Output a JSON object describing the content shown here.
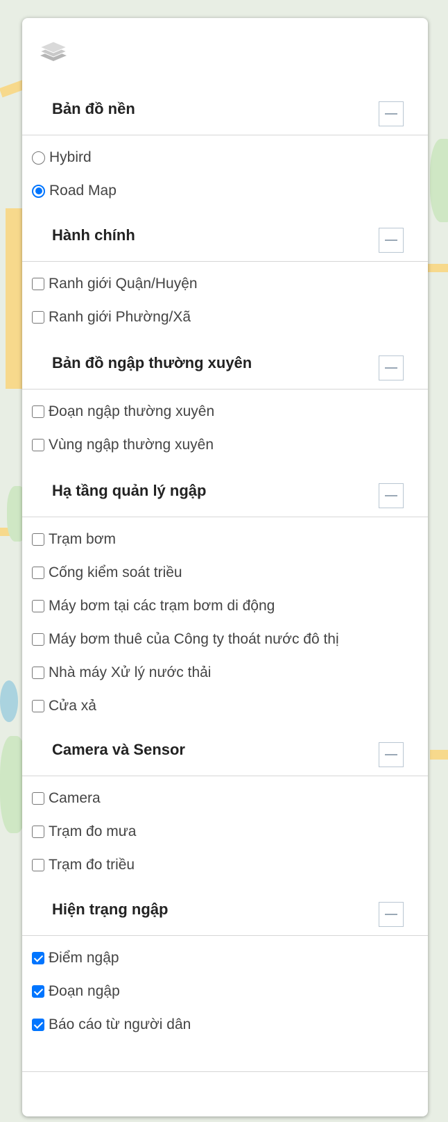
{
  "sections": [
    {
      "title": "Bản đồ nền",
      "type": "radio",
      "items": [
        {
          "label": "Hybird",
          "checked": false
        },
        {
          "label": "Road Map",
          "checked": true
        }
      ]
    },
    {
      "title": "Hành chính",
      "type": "checkbox",
      "items": [
        {
          "label": "Ranh giới Quận/Huyện",
          "checked": false
        },
        {
          "label": "Ranh giới Phường/Xã",
          "checked": false
        }
      ]
    },
    {
      "title": "Bản đồ ngập thường xuyên",
      "type": "checkbox",
      "items": [
        {
          "label": "Đoạn ngập thường xuyên",
          "checked": false
        },
        {
          "label": "Vùng ngập thường xuyên",
          "checked": false
        }
      ]
    },
    {
      "title": "Hạ tầng quản lý ngập",
      "type": "checkbox",
      "items": [
        {
          "label": "Trạm bơm",
          "checked": false
        },
        {
          "label": "Cống kiểm soát triều",
          "checked": false
        },
        {
          "label": "Máy bơm tại các trạm bơm di động",
          "checked": false
        },
        {
          "label": "Máy bơm thuê của Công ty thoát nước đô thị",
          "checked": false
        },
        {
          "label": "Nhà máy Xử lý nước thải",
          "checked": false
        },
        {
          "label": "Cửa xả",
          "checked": false
        }
      ]
    },
    {
      "title": "Camera và Sensor",
      "type": "checkbox",
      "items": [
        {
          "label": "Camera",
          "checked": false
        },
        {
          "label": "Trạm đo mưa",
          "checked": false
        },
        {
          "label": "Trạm đo triều",
          "checked": false
        }
      ]
    },
    {
      "title": "Hiện trạng ngập",
      "type": "checkbox",
      "items": [
        {
          "label": "Điểm ngập",
          "checked": true
        },
        {
          "label": "Đoạn ngập",
          "checked": true
        },
        {
          "label": "Báo cáo từ người dân",
          "checked": true
        }
      ]
    }
  ]
}
